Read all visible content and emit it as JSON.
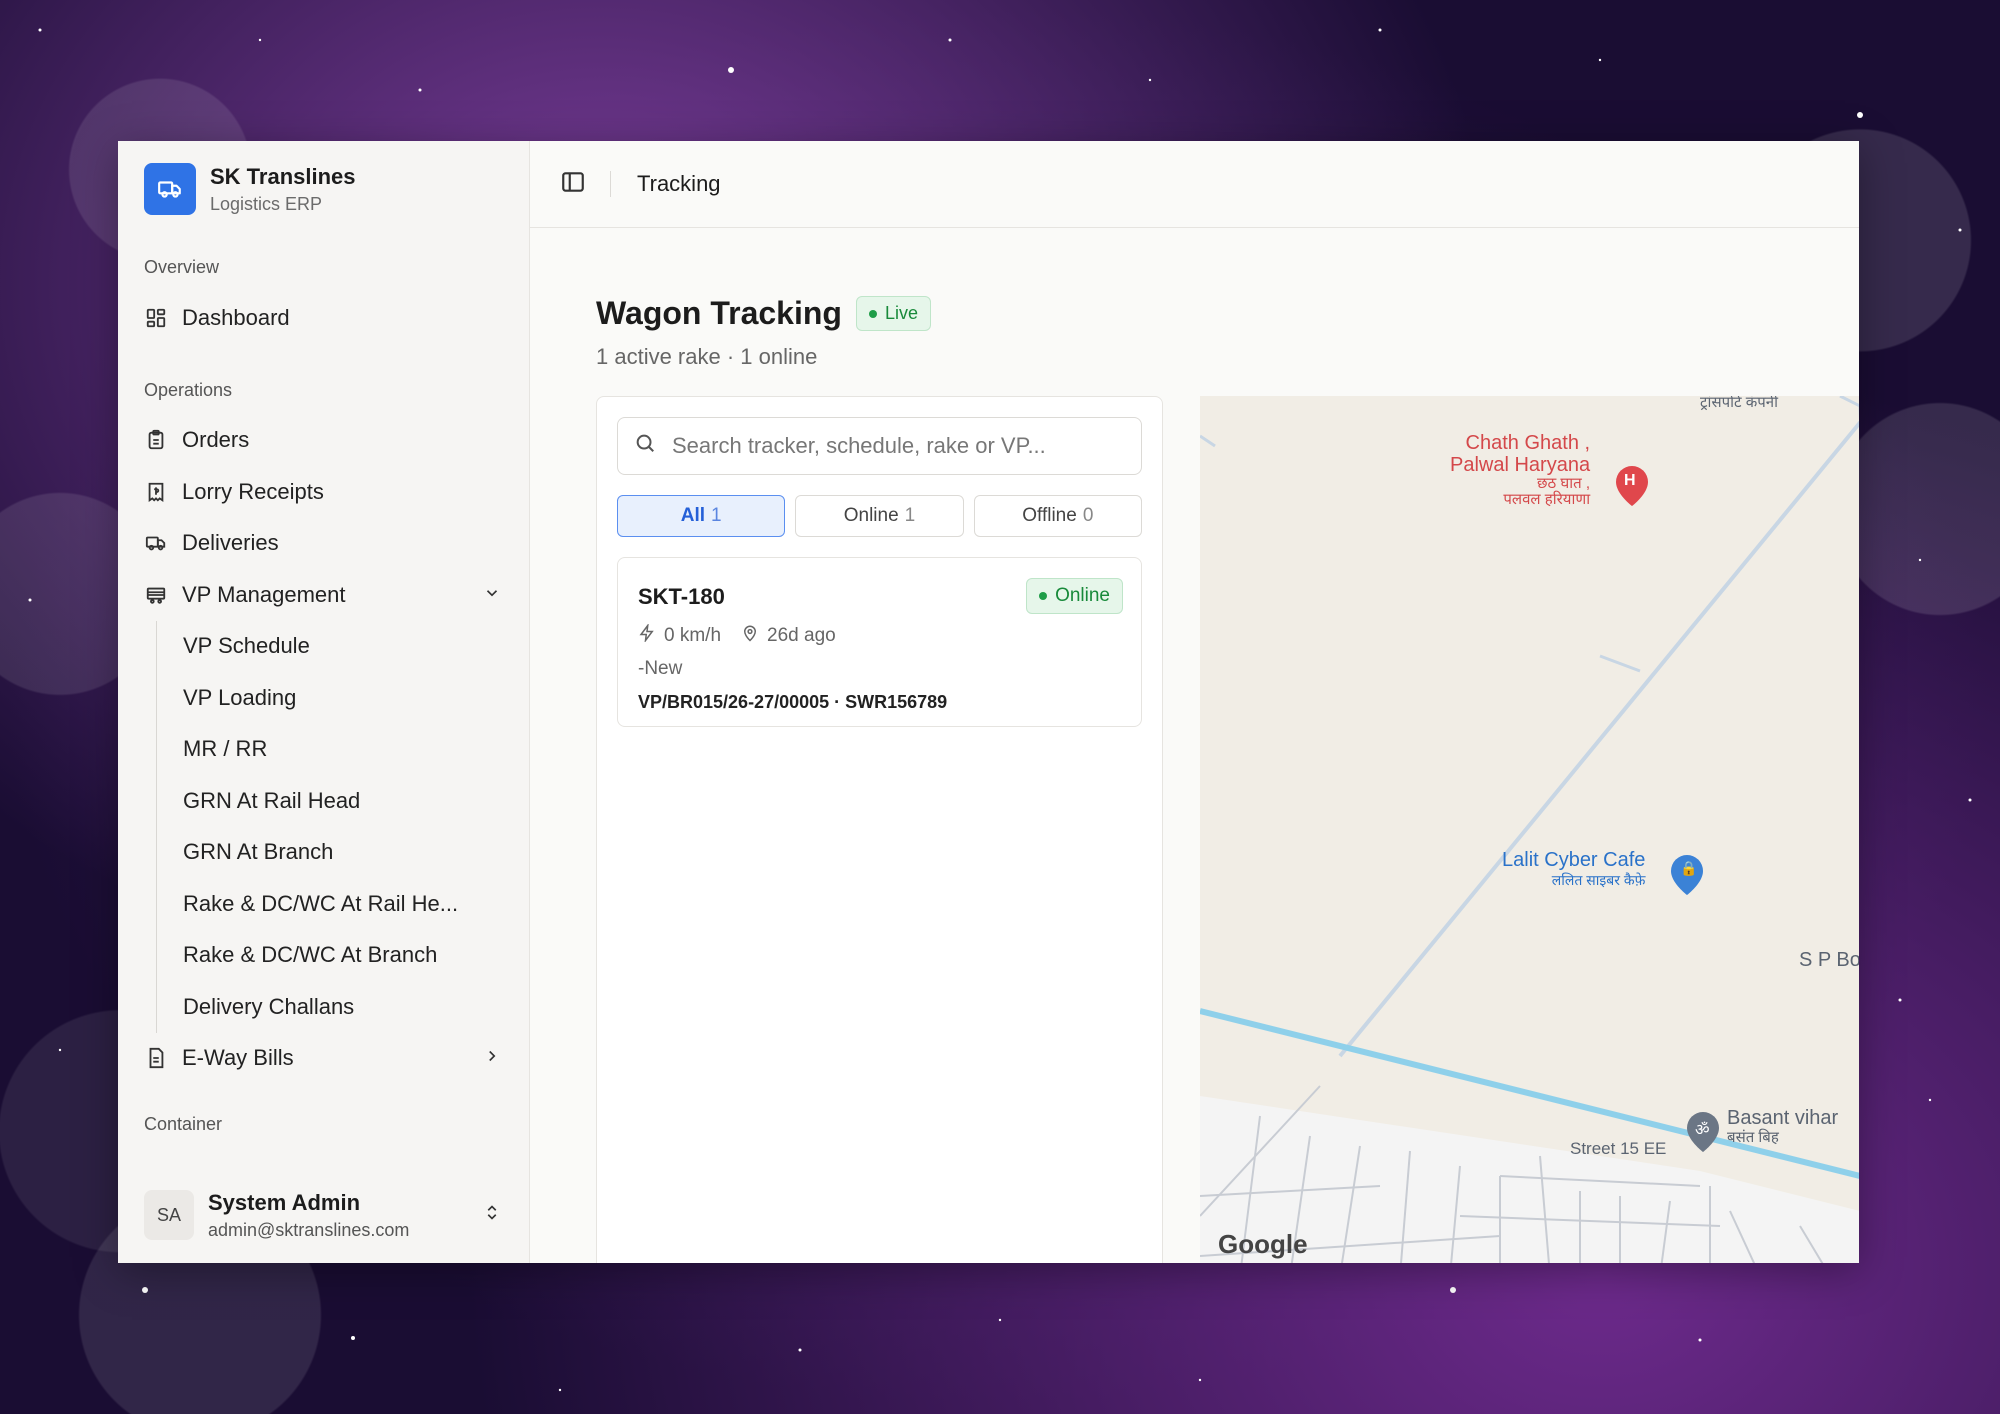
{
  "brand": {
    "name": "SK Translines",
    "subtitle": "Logistics ERP"
  },
  "sidebar": {
    "overview_label": "Overview",
    "dashboard": "Dashboard",
    "operations_label": "Operations",
    "orders": "Orders",
    "lorry_receipts": "Lorry Receipts",
    "deliveries": "Deliveries",
    "vp_management": "VP Management",
    "vp_sub": [
      "VP Schedule",
      "VP Loading",
      "MR / RR",
      "GRN At Rail Head",
      "GRN At Branch",
      "Rake & DC/WC At Rail He...",
      "Rake & DC/WC At Branch",
      "Delivery Challans"
    ],
    "eway_bills": "E-Way Bills",
    "container_label": "Container"
  },
  "user": {
    "initials": "SA",
    "name": "System Admin",
    "email": "admin@sktranslines.com"
  },
  "topbar": {
    "title": "Tracking"
  },
  "page": {
    "title": "Wagon Tracking",
    "live_badge": "Live",
    "subtitle": "1 active rake · 1 online"
  },
  "search": {
    "placeholder": "Search tracker, schedule, rake or VP..."
  },
  "filters": [
    {
      "label": "All",
      "count": "1",
      "active": true
    },
    {
      "label": "Online",
      "count": "1",
      "active": false
    },
    {
      "label": "Offline",
      "count": "0",
      "active": false
    }
  ],
  "tracker": {
    "rake": "SKT-180",
    "status_badge": "Online",
    "speed": "0 km/h",
    "last_seen": "26d ago",
    "status": "-New",
    "reference": "VP/BR015/26-27/00005 · SWR156789"
  },
  "map": {
    "poi_top": "ट्रांसपोर्ट कंपनी",
    "poi_hospital": "Chath Ghath ,",
    "poi_hospital_2": "Palwal Haryana",
    "poi_hospital_hi": "छठ घात ,",
    "poi_hospital_hi_2": "पलवल हरियाणा",
    "poi_cafe": "Lalit Cyber Cafe",
    "poi_cafe_hi": "ललित साइबर कैफ़े",
    "poi_sp": "S P Box",
    "poi_basant": "Basant vihar",
    "poi_basant_hi": "बसंत बिह",
    "street": "Street 15 EE",
    "attribution": "Google",
    "colors": {
      "road": "#8fd0ea",
      "hospital": "#e0474c",
      "cafe": "#3b82d6",
      "temple": "#6b7685"
    }
  }
}
